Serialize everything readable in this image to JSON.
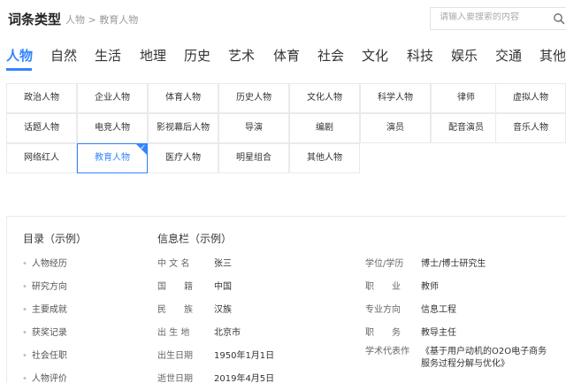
{
  "header": {
    "title": "词条类型",
    "breadcrumb": "人物 > 教育人物",
    "search_placeholder": "请输入要搜索的内容",
    "search_value": ""
  },
  "tabs": [
    "人物",
    "自然",
    "生活",
    "地理",
    "历史",
    "艺术",
    "体育",
    "社会",
    "文化",
    "科技",
    "娱乐",
    "交通",
    "其他"
  ],
  "active_tab": "人物",
  "accent_color": "#3385ff",
  "subcategories": [
    [
      "政治人物",
      "企业人物",
      "体育人物",
      "历史人物",
      "文化人物",
      "科学人物",
      "律师",
      "虚拟人物"
    ],
    [
      "话题人物",
      "电竞人物",
      "影视幕后人物",
      "导演",
      "编剧",
      "演员",
      "配音演员",
      "音乐人物"
    ],
    [
      "网络红人",
      "教育人物",
      "医疗人物",
      "明星组合",
      "其他人物"
    ]
  ],
  "active_subcategory": "教育人物",
  "toc": {
    "title": "目录（示例）",
    "items": [
      "人物经历",
      "研究方向",
      "主要成就",
      "获奖记录",
      "社会任职",
      "人物评价"
    ]
  },
  "infobox": {
    "title": "信息栏（示例）",
    "left": [
      {
        "label": "中 文 名",
        "value": "张三"
      },
      {
        "label": "国　　籍",
        "value": "中国"
      },
      {
        "label": "民　　族",
        "value": "汉族"
      },
      {
        "label": "出 生 地",
        "value": "北京市"
      },
      {
        "label": "出生日期",
        "value": "1950年1月1日"
      },
      {
        "label": "逝世日期",
        "value": "2019年4月5日"
      }
    ],
    "right": [
      {
        "label": "学位/学历",
        "value": "博士/博士研究生"
      },
      {
        "label": "职　　业",
        "value": "教师"
      },
      {
        "label": "专业方向",
        "value": "信息工程"
      },
      {
        "label": "职　　务",
        "value": "教导主任"
      },
      {
        "label": "学术代表作",
        "value": "《基于用户动机的O2O电子商务服务过程分解与优化》"
      }
    ]
  }
}
